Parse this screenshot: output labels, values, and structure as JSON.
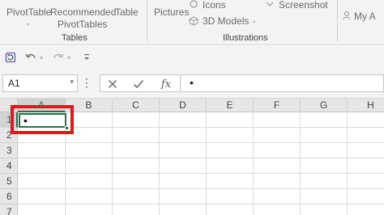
{
  "ribbon": {
    "pivottable_label": "PivotTable",
    "recommended_label_1": "Recommended",
    "recommended_label_2": "PivotTables",
    "table_label": "Table",
    "tables_group": "Tables",
    "pictures_label": "Pictures",
    "icons_label": "Icons",
    "models_label": "3D Models",
    "screenshot_label": "Screenshot",
    "illustrations_group": "Illustrations",
    "addins_label": "My A"
  },
  "formula_bar": {
    "name_box": "A1",
    "fx_label": "fx",
    "formula_value": "•"
  },
  "grid": {
    "columns": [
      "A",
      "B",
      "C",
      "D",
      "E",
      "F",
      "G",
      "H"
    ],
    "rows": [
      "1",
      "2",
      "3",
      "4",
      "5",
      "6",
      "7"
    ],
    "active_cell_value": "•"
  },
  "colors": {
    "accent": "#217346",
    "highlight": "#e8141b"
  }
}
